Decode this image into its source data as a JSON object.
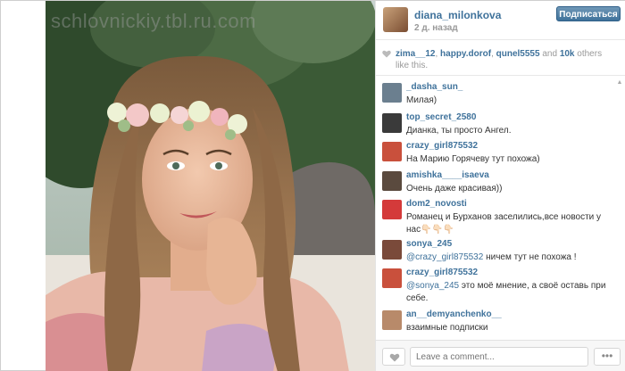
{
  "watermark": "schlovnickiy.tbl.ru.com",
  "post": {
    "username": "diana_milonkova",
    "time": "2 д. назад",
    "follow_label": "Подписаться"
  },
  "likes": {
    "users": [
      "zima__12",
      "happy.dorof",
      "qunel5555"
    ],
    "sep1": ", ",
    "sep2": ", ",
    "and_text": " and ",
    "count": "10k",
    "suffix": " others like this."
  },
  "comments": [
    {
      "user": "_dasha_sun_",
      "text": "Милая)",
      "avatar_color": "#6b7f8f"
    },
    {
      "user": "top_secret_2580",
      "text": "Дианка, ты просто Ангел.",
      "avatar_color": "#3a3a3a"
    },
    {
      "user": "crazy_girl875532",
      "text": "На Марию Горячеву тут похожа)",
      "avatar_color": "#c9503c"
    },
    {
      "user": "amishka____isaeva",
      "text": "Очень даже красивая))",
      "avatar_color": "#5a4a3e"
    },
    {
      "user": "dom2_novosti",
      "text": "Романец и Бурханов заселились,все новости у нас👇🏻👇🏻👇🏻",
      "avatar_color": "#d43a3a"
    },
    {
      "user": "sonya_245",
      "mention": "@crazy_girl875532",
      "text": " ничем тут не похожа !",
      "avatar_color": "#7a4a3a"
    },
    {
      "user": "crazy_girl875532",
      "mention": "@sonya_245",
      "text": " это моё мнение, а своё оставь при себе.",
      "avatar_color": "#c9503c"
    },
    {
      "user": "an__demyanchenko__",
      "text": "взаимные подписки",
      "avatar_color": "#b88a6a"
    }
  ],
  "footer": {
    "comment_placeholder": "Leave a comment...",
    "more_label": "•••"
  },
  "icons": {
    "heart": "heart-icon",
    "more": "ellipsis-icon"
  }
}
